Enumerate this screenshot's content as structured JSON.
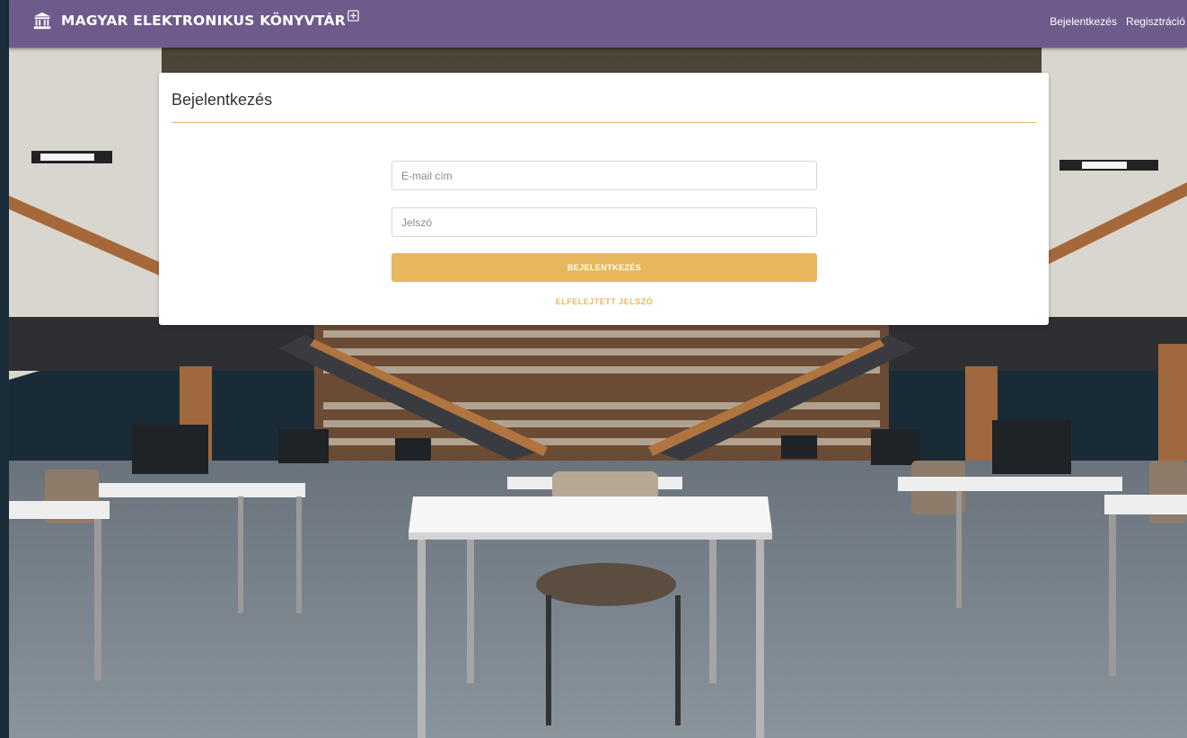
{
  "header": {
    "brand": "MAGYAR ELEKTRONIKUS KÖNYVTÁR",
    "brand_icon": "library-building-icon",
    "brand_badge_icon": "plus-box-icon",
    "nav": {
      "login": "Bejelentkezés",
      "register": "Regisztráció"
    }
  },
  "login": {
    "title": "Bejelentkezés",
    "email_placeholder": "E-mail cím",
    "password_placeholder": "Jelszó",
    "submit_label": "BEJELENTKEZÉS",
    "forgot_label": "ELFELEJTETT JELSZÓ"
  },
  "colors": {
    "topbar": "#6f5b8b",
    "accent": "#e7b75e",
    "frame": "#1b2c3a"
  },
  "background": {
    "scene": "library-reading-room-photo"
  }
}
